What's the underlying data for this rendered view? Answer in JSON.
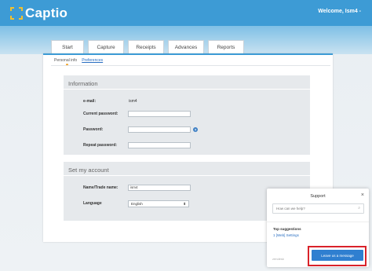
{
  "app": {
    "logo_text": "Captio",
    "welcome": "Welcome, Ism4 -"
  },
  "tabs": [
    {
      "label": "Start"
    },
    {
      "label": "Capture"
    },
    {
      "label": "Receipts"
    },
    {
      "label": "Advances"
    },
    {
      "label": "Reports"
    }
  ],
  "subtabs": {
    "personal_info": "Personal info",
    "preferences": "Preferences"
  },
  "information": {
    "title": "Information",
    "email_label": "e-mail:",
    "email_value": "ism4",
    "current_password_label": "Current password:",
    "password_label": "Password:",
    "repeat_password_label": "Repeat password:",
    "help_glyph": "?"
  },
  "account": {
    "title": "Set my account",
    "name_label": "Name/Trade name:",
    "name_value": "ism4",
    "language_label": "Language",
    "language_value": "English",
    "language_arrow": "⬍"
  },
  "support": {
    "title": "Support",
    "close": "×",
    "search_placeholder": "How can we help?",
    "search_icon": "⌕",
    "top_suggestions": "Top suggestions",
    "suggestion_1": "1  [Web] Settings",
    "brand": "zendesk",
    "leave_message": "Leave us a message"
  }
}
